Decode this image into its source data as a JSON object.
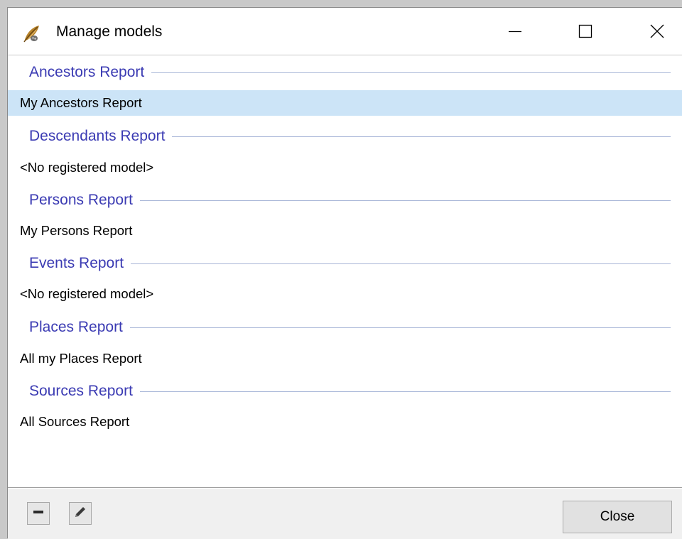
{
  "window": {
    "title": "Manage models",
    "app_icon": "feather-quill-icon"
  },
  "title_buttons": {
    "minimize": "minimize-icon",
    "maximize": "maximize-icon",
    "close": "close-icon"
  },
  "groups": [
    {
      "title": "Ancestors Report",
      "models": [
        "My Ancestors Report"
      ],
      "selected": true
    },
    {
      "title": "Descendants Report",
      "models": [
        "<No registered model>"
      ],
      "selected": false
    },
    {
      "title": "Persons Report",
      "models": [
        "My Persons Report"
      ],
      "selected": false
    },
    {
      "title": "Events Report",
      "models": [
        "<No registered model>"
      ],
      "selected": false
    },
    {
      "title": "Places Report",
      "models": [
        "All my Places Report"
      ],
      "selected": false
    },
    {
      "title": "Sources Report",
      "models": [
        "All Sources Report"
      ],
      "selected": false
    }
  ],
  "footer": {
    "remove_icon": "minus-icon",
    "edit_icon": "pencil-icon",
    "close_label": "Close"
  },
  "colors": {
    "group_title": "#3b3bb3",
    "group_line": "#a9b7d8",
    "selection": "#cce4f7"
  }
}
